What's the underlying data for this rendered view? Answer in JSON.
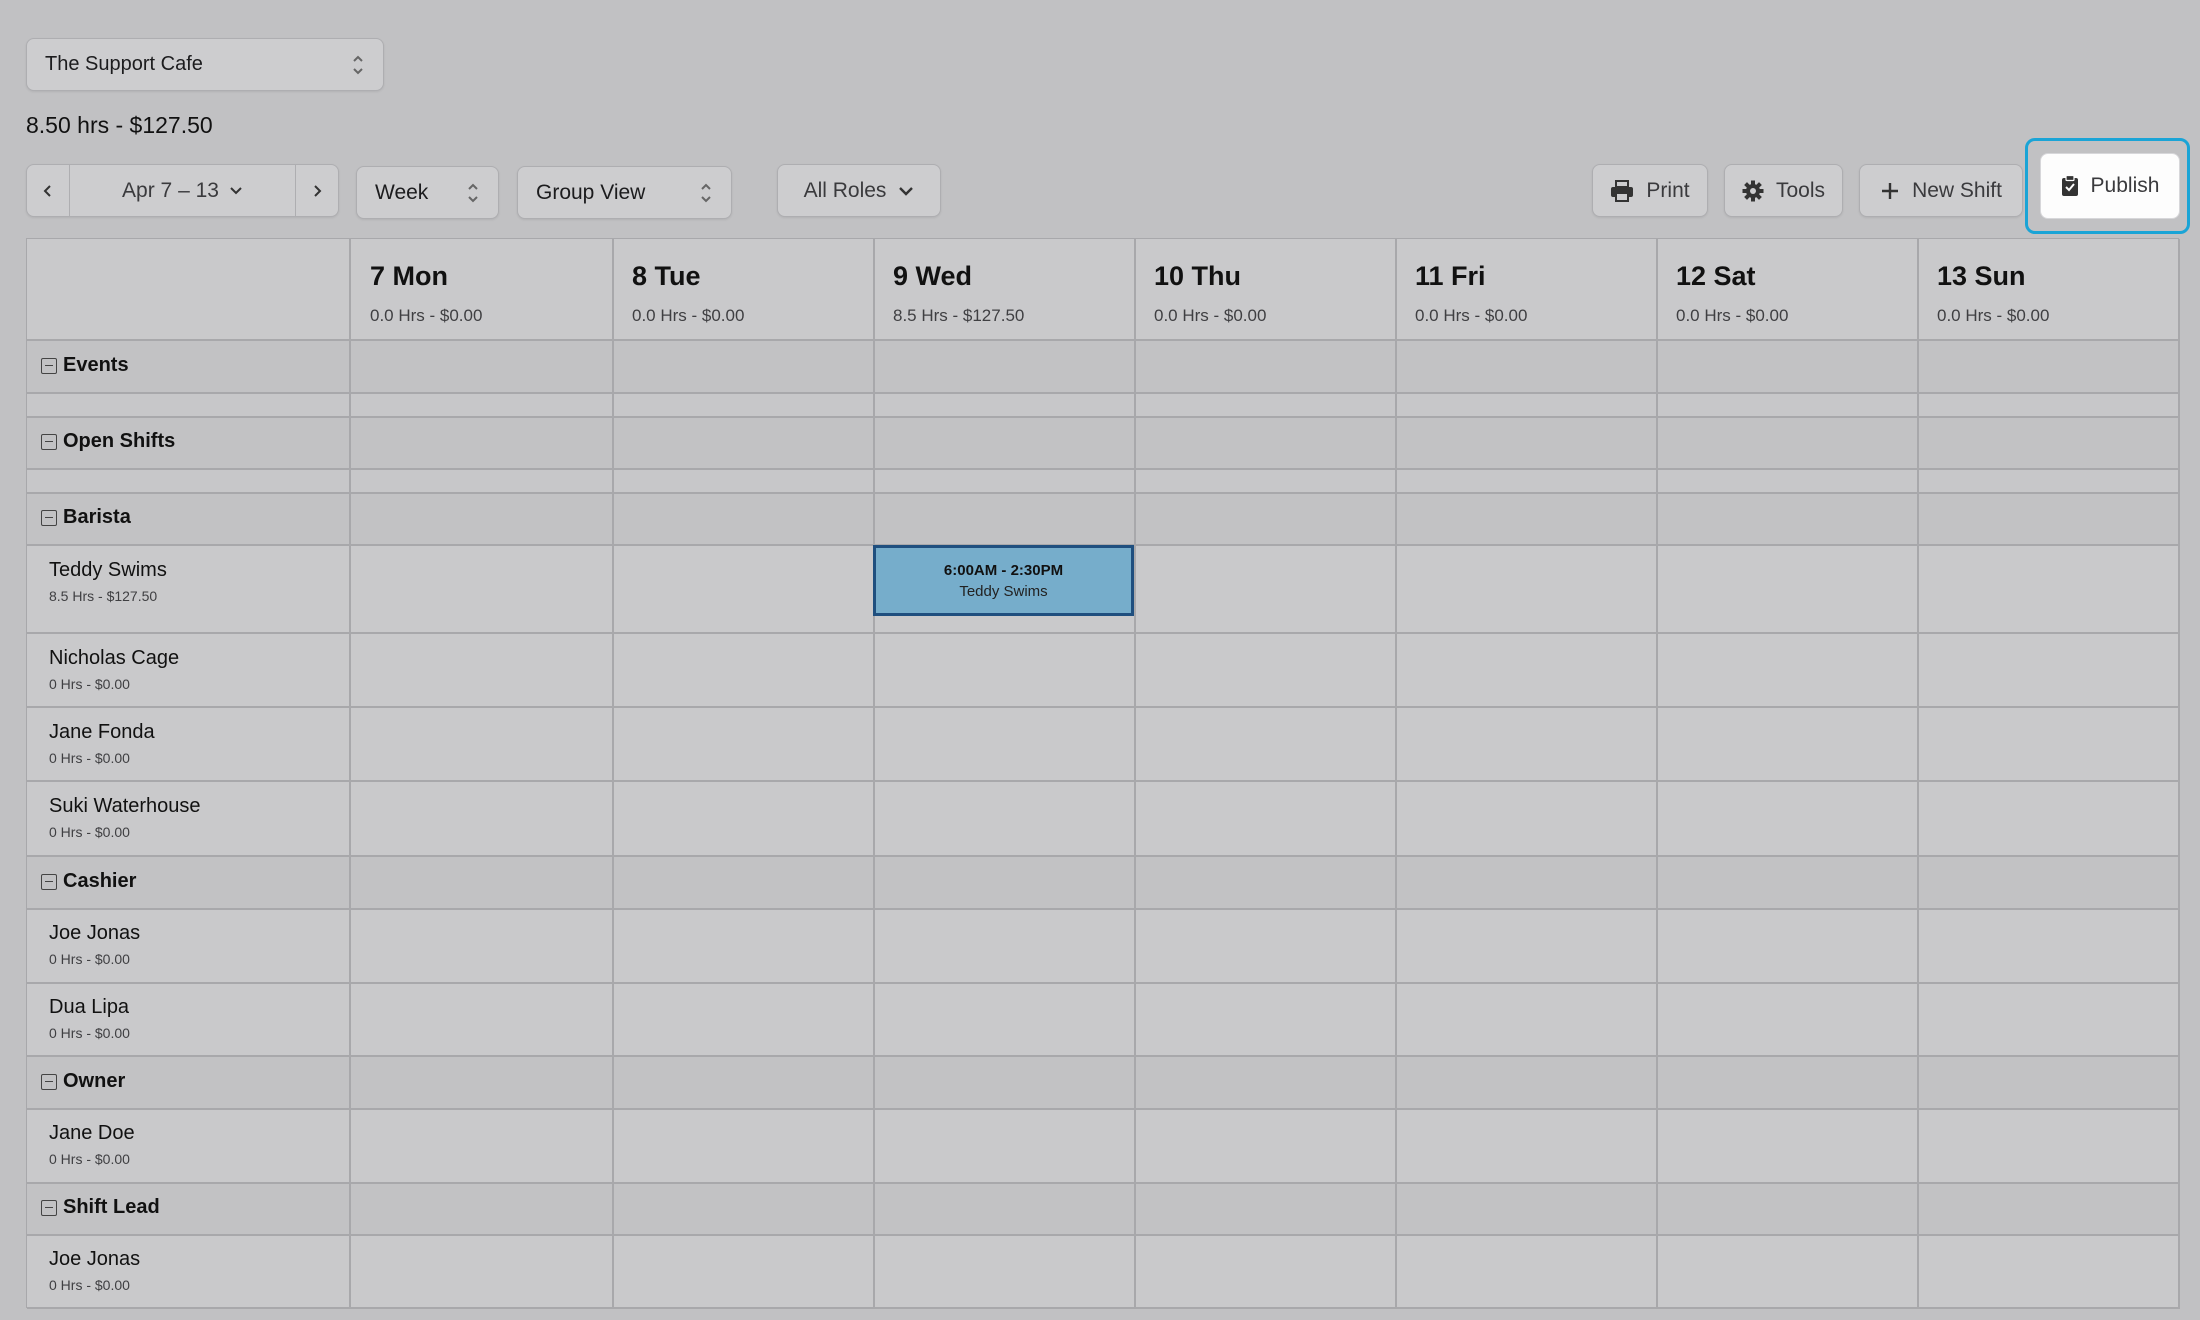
{
  "location": {
    "selected": "The Support Cafe"
  },
  "summary": "8.50 hrs - $127.50",
  "toolbar": {
    "date_range": "Apr 7 – 13",
    "view_mode": "Week",
    "group_view": "Group View",
    "roles_filter": "All Roles",
    "print_label": "Print",
    "tools_label": "Tools",
    "new_shift_label": "New Shift",
    "publish_label": "Publish"
  },
  "days": [
    {
      "name": "7 Mon",
      "stats": "0.0 Hrs - $0.00"
    },
    {
      "name": "8 Tue",
      "stats": "0.0 Hrs - $0.00"
    },
    {
      "name": "9 Wed",
      "stats": "8.5 Hrs - $127.50"
    },
    {
      "name": "10 Thu",
      "stats": "0.0 Hrs - $0.00"
    },
    {
      "name": "11 Fri",
      "stats": "0.0 Hrs - $0.00"
    },
    {
      "name": "12 Sat",
      "stats": "0.0 Hrs - $0.00"
    },
    {
      "name": "13 Sun",
      "stats": "0.0 Hrs - $0.00"
    }
  ],
  "groups": {
    "events": "Events",
    "open_shifts": "Open Shifts",
    "barista": "Barista",
    "cashier": "Cashier",
    "owner": "Owner",
    "shift_lead": "Shift Lead"
  },
  "people": [
    {
      "name": "Teddy Swims",
      "stats": "8.5 Hrs - $127.50"
    },
    {
      "name": "Nicholas Cage",
      "stats": "0 Hrs - $0.00"
    },
    {
      "name": "Jane Fonda",
      "stats": "0 Hrs - $0.00"
    },
    {
      "name": "Suki Waterhouse",
      "stats": "0 Hrs - $0.00"
    },
    {
      "name": "Joe Jonas",
      "stats": "0 Hrs - $0.00"
    },
    {
      "name": "Dua Lipa",
      "stats": "0 Hrs - $0.00"
    },
    {
      "name": "Jane Doe",
      "stats": "0 Hrs - $0.00"
    },
    {
      "name": "Joe Jonas",
      "stats": "0 Hrs - $0.00"
    }
  ],
  "shifts": [
    {
      "time": "6:00AM - 2:30PM",
      "employee": "Teddy Swims"
    }
  ],
  "colors": {
    "accent": "#1aa4d6",
    "shift_fill": "#76adcb",
    "shift_border": "#1f4f7f"
  }
}
